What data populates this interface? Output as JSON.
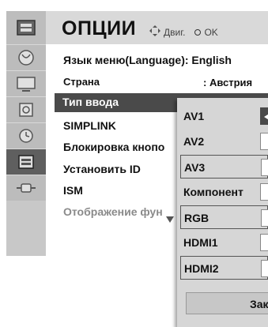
{
  "header": {
    "title": "ОПЦИИ",
    "nav_hint": "Двиг.",
    "ok_hint": "OK"
  },
  "sidebar": {
    "icons": [
      "options-tv-icon",
      "satellite-dish-icon",
      "monitor-icon",
      "speaker-icon",
      "clock-icon",
      "options-tv-icon",
      "plug-icon"
    ],
    "active_index": 5
  },
  "menu": {
    "items": [
      {
        "label": "Язык меню(Language): English"
      },
      {
        "label": "Страна",
        "value": ": Австрия"
      },
      {
        "label": "Тип ввода"
      },
      {
        "label": "SIMPLINK"
      },
      {
        "label": "Блокировка кнопо"
      },
      {
        "label": "Установить ID"
      },
      {
        "label": "ISM"
      },
      {
        "label": "Отображение фун"
      }
    ]
  },
  "popup": {
    "options": [
      {
        "label": "AV1",
        "selected": true
      },
      {
        "label": "AV2",
        "selected": false
      },
      {
        "label": "AV3",
        "selected": false
      },
      {
        "label": "Компонент",
        "selected": false
      },
      {
        "label": "RGB",
        "selected": false
      },
      {
        "label": "HDMI1",
        "selected": false
      },
      {
        "label": "HDMI2",
        "selected": false
      }
    ],
    "close_label": "Зак"
  }
}
